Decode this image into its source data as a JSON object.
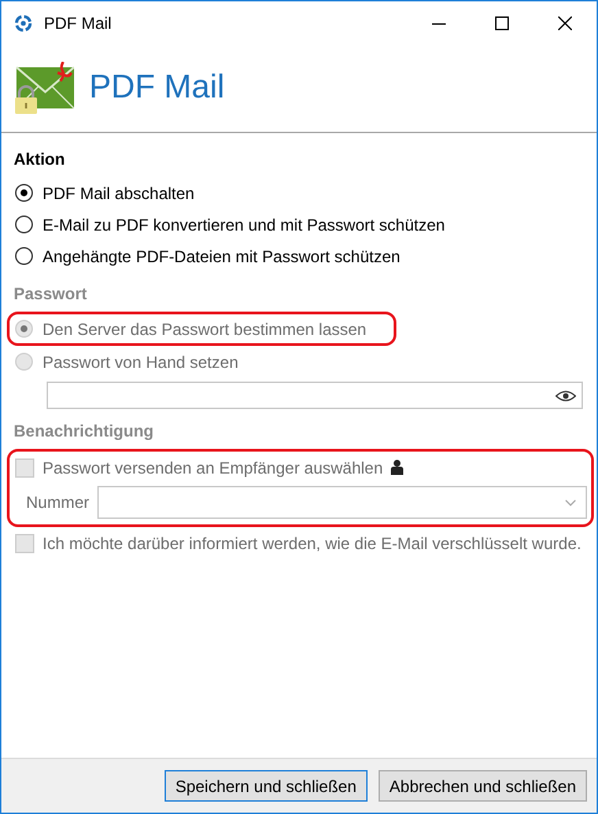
{
  "window": {
    "title": "PDF Mail"
  },
  "header": {
    "title": "PDF Mail"
  },
  "sections": [
    {
      "heading": "Aktion",
      "disabled": false,
      "items": [
        {
          "kind": "radio",
          "label": "PDF Mail abschalten",
          "selected": true,
          "disabled": false,
          "highlighted": false
        },
        {
          "kind": "radio",
          "label": "E-Mail zu PDF konvertieren und mit Passwort schützen",
          "selected": false,
          "disabled": false,
          "highlighted": false
        },
        {
          "kind": "radio",
          "label": "Angehängte PDF-Dateien mit Passwort schützen",
          "selected": false,
          "disabled": false,
          "highlighted": false
        }
      ]
    },
    {
      "heading": "Passwort",
      "disabled": true,
      "items": [
        {
          "kind": "radio",
          "label": "Den Server das Passwort bestimmen lassen",
          "selected": true,
          "disabled": true,
          "highlighted": true
        },
        {
          "kind": "radio",
          "label": "Passwort von Hand setzen",
          "selected": false,
          "disabled": true,
          "highlighted": false
        },
        {
          "kind": "password",
          "disabled": true,
          "highlighted": false
        }
      ]
    },
    {
      "heading": "Benachrichtigung",
      "disabled": true,
      "items": [
        {
          "kind": "group",
          "highlighted": true,
          "children": [
            {
              "kind": "checkbox",
              "label": "Passwort versenden an Empfänger auswählen",
              "checked": false,
              "disabled": true,
              "contact_icon": true
            },
            {
              "kind": "combo",
              "label": "Nummer",
              "disabled": true
            }
          ]
        },
        {
          "kind": "checkbox",
          "label": "Ich möchte darüber informiert werden, wie die E-Mail verschlüsselt wurde.",
          "checked": false,
          "disabled": true,
          "highlighted": false
        }
      ]
    }
  ],
  "buttons": [
    {
      "label": "Speichern und schließen",
      "default": true
    },
    {
      "label": "Abbrechen und schließen",
      "default": false
    }
  ]
}
